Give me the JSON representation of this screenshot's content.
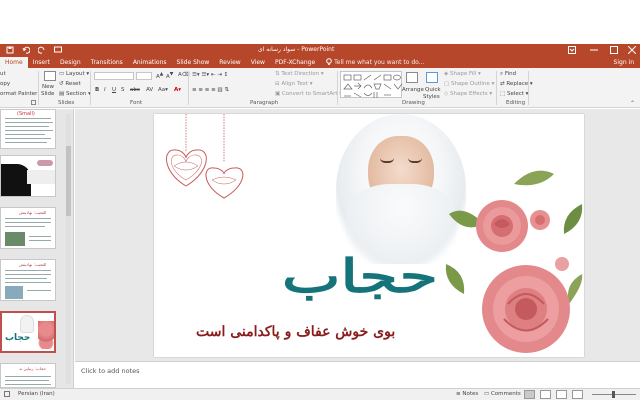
{
  "window": {
    "title": "سواد رسانه ای  -  PowerPoint",
    "minimize_icon": "minimize-icon",
    "restore_icon": "restore-icon",
    "close_icon": "close-icon"
  },
  "ribbon_tabs": [
    "Home",
    "Insert",
    "Design",
    "Transitions",
    "Animations",
    "Slide Show",
    "Review",
    "View",
    "PDF-XChange"
  ],
  "tell_me": "Tell me what you want to do...",
  "sign_in": "Sign in",
  "clipboard": {
    "cut": "ut",
    "copy": "opy",
    "format_painter": "ormat Painter"
  },
  "slides_group": {
    "new_slide_1": "New",
    "new_slide_2": "Slide",
    "layout": "Layout",
    "reset": "Reset",
    "section": "Section",
    "label": "Slides"
  },
  "font_group": {
    "label": "Font",
    "bold": "B",
    "italic": "I",
    "underline": "U",
    "strike": "S",
    "shadow": "abc"
  },
  "paragraph_group": {
    "label": "Paragraph",
    "text_direction": "Text Direction",
    "align_text": "Align Text",
    "convert_smartart": "Convert to SmartArt"
  },
  "drawing_group": {
    "label": "Drawing",
    "arrange": "Arrange",
    "quick_styles_1": "Quick",
    "quick_styles_2": "Styles",
    "shape_fill": "Shape Fill",
    "shape_outline": "Shape Outline",
    "shape_effects": "Shape Effects"
  },
  "editing_group": {
    "label": "Editing",
    "find": "Find",
    "replace": "Replace",
    "select": "Select"
  },
  "thumbnails": [
    {
      "caption": "(Small)",
      "kind": "text"
    },
    {
      "caption": "",
      "kind": "black"
    },
    {
      "caption": "الفعيت: نهادينش",
      "kind": "textimg"
    },
    {
      "caption": "الفعيت: نهادينش",
      "kind": "textimg2"
    },
    {
      "caption": "",
      "kind": "selected"
    },
    {
      "caption": "حجاب: زيبايي ند",
      "kind": "text2"
    }
  ],
  "slide": {
    "main_title": "حجاب",
    "subtitle": "بوی خوش عفاف و پاکدامنی است",
    "colors": {
      "title": "#157479",
      "subtitle": "#8a1c1c",
      "rose": "#e0787a",
      "leaf": "#7a9a4a"
    }
  },
  "notes_placeholder": "Click to add notes",
  "status": {
    "language": "Persian (Iran)",
    "notes": "Notes",
    "comments": "Comments"
  },
  "colors": {
    "accent": "#b7472a"
  }
}
